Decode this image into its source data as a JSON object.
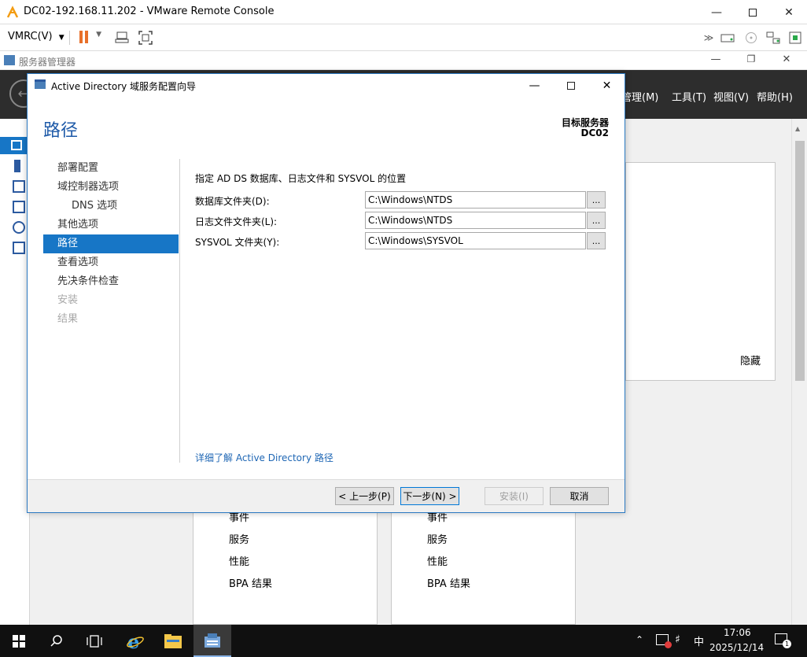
{
  "vmrc": {
    "title": "DC02-192.168.11.202 - VMware Remote Console",
    "menu_label": "VMRC(V)",
    "icons": [
      "vmware-logo-icon",
      "pause-icon",
      "send-ctrl-alt-del-icon",
      "fullscreen-icon",
      "more-icon",
      "hdd-icon",
      "cd-icon",
      "network-icon"
    ]
  },
  "server_manager": {
    "title": "服务器管理器",
    "menu": {
      "manage": "管理(M)",
      "tools": "工具(T)",
      "view": "视图(V)",
      "help": "帮助(H)"
    },
    "tile_hide": "隐藏",
    "panel_left_items": [
      "事件",
      "服务",
      "性能",
      "BPA 结果"
    ],
    "panel_right_items": [
      "事件",
      "服务",
      "性能",
      "BPA 结果"
    ]
  },
  "dialog": {
    "title": "Active Directory 域服务配置向导",
    "heading": "路径",
    "target_label": "目标服务器",
    "target_name": "DC02",
    "nav": [
      {
        "label": "部署配置",
        "state": "normal"
      },
      {
        "label": "域控制器选项",
        "state": "normal"
      },
      {
        "label": "DNS 选项",
        "state": "sub"
      },
      {
        "label": "其他选项",
        "state": "normal"
      },
      {
        "label": "路径",
        "state": "active"
      },
      {
        "label": "查看选项",
        "state": "normal"
      },
      {
        "label": "先决条件检查",
        "state": "normal"
      },
      {
        "label": "安装",
        "state": "disabled"
      },
      {
        "label": "结果",
        "state": "disabled"
      }
    ],
    "description": "指定 AD DS 数据库、日志文件和 SYSVOL 的位置",
    "fields": {
      "database": {
        "label": "数据库文件夹(D):",
        "value": "C:\\Windows\\NTDS"
      },
      "log": {
        "label": "日志文件文件夹(L):",
        "value": "C:\\Windows\\NTDS"
      },
      "sysvol": {
        "label": "SYSVOL 文件夹(Y):",
        "value": "C:\\Windows\\SYSVOL"
      }
    },
    "browse_label": "...",
    "learn_more": "详细了解 Active Directory 路径",
    "buttons": {
      "back": "< 上一步(P)",
      "next": "下一步(N) >",
      "install": "安装(I)",
      "cancel": "取消"
    }
  },
  "taskbar": {
    "time": "17:06",
    "date": "2025/12/14",
    "ime": "中"
  }
}
